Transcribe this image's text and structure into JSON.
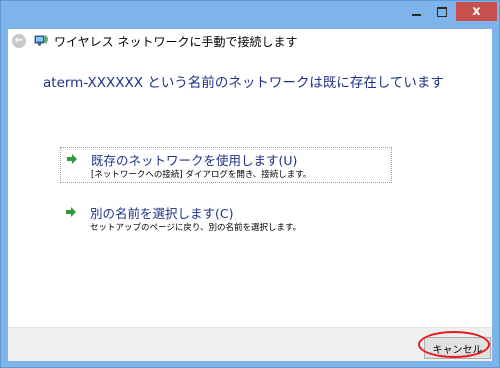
{
  "dialog": {
    "title": "ワイヤレス ネットワークに手動で接続します",
    "heading": "aterm-XXXXXX という名前のネットワークは既に存在しています"
  },
  "options": [
    {
      "title": "既存のネットワークを使用します(U)",
      "description": "[ネットワークへの接続] ダイアログを開き、接続します。"
    },
    {
      "title": "別の名前を選択します(C)",
      "description": "セットアップのページに戻り、別の名前を選択します。"
    }
  ],
  "buttons": {
    "cancel": "キャンセル",
    "close": "x"
  },
  "colors": {
    "titlebar": "#7eb4ea",
    "close_button": "#c7504c",
    "heading_text": "#1e3287",
    "arrow_icon": "#2e9a3c",
    "annotation_ring": "#e8191b"
  },
  "icons": {
    "back": "back-arrow-icon",
    "network": "network-icon",
    "option": "green-arrow-icon"
  }
}
